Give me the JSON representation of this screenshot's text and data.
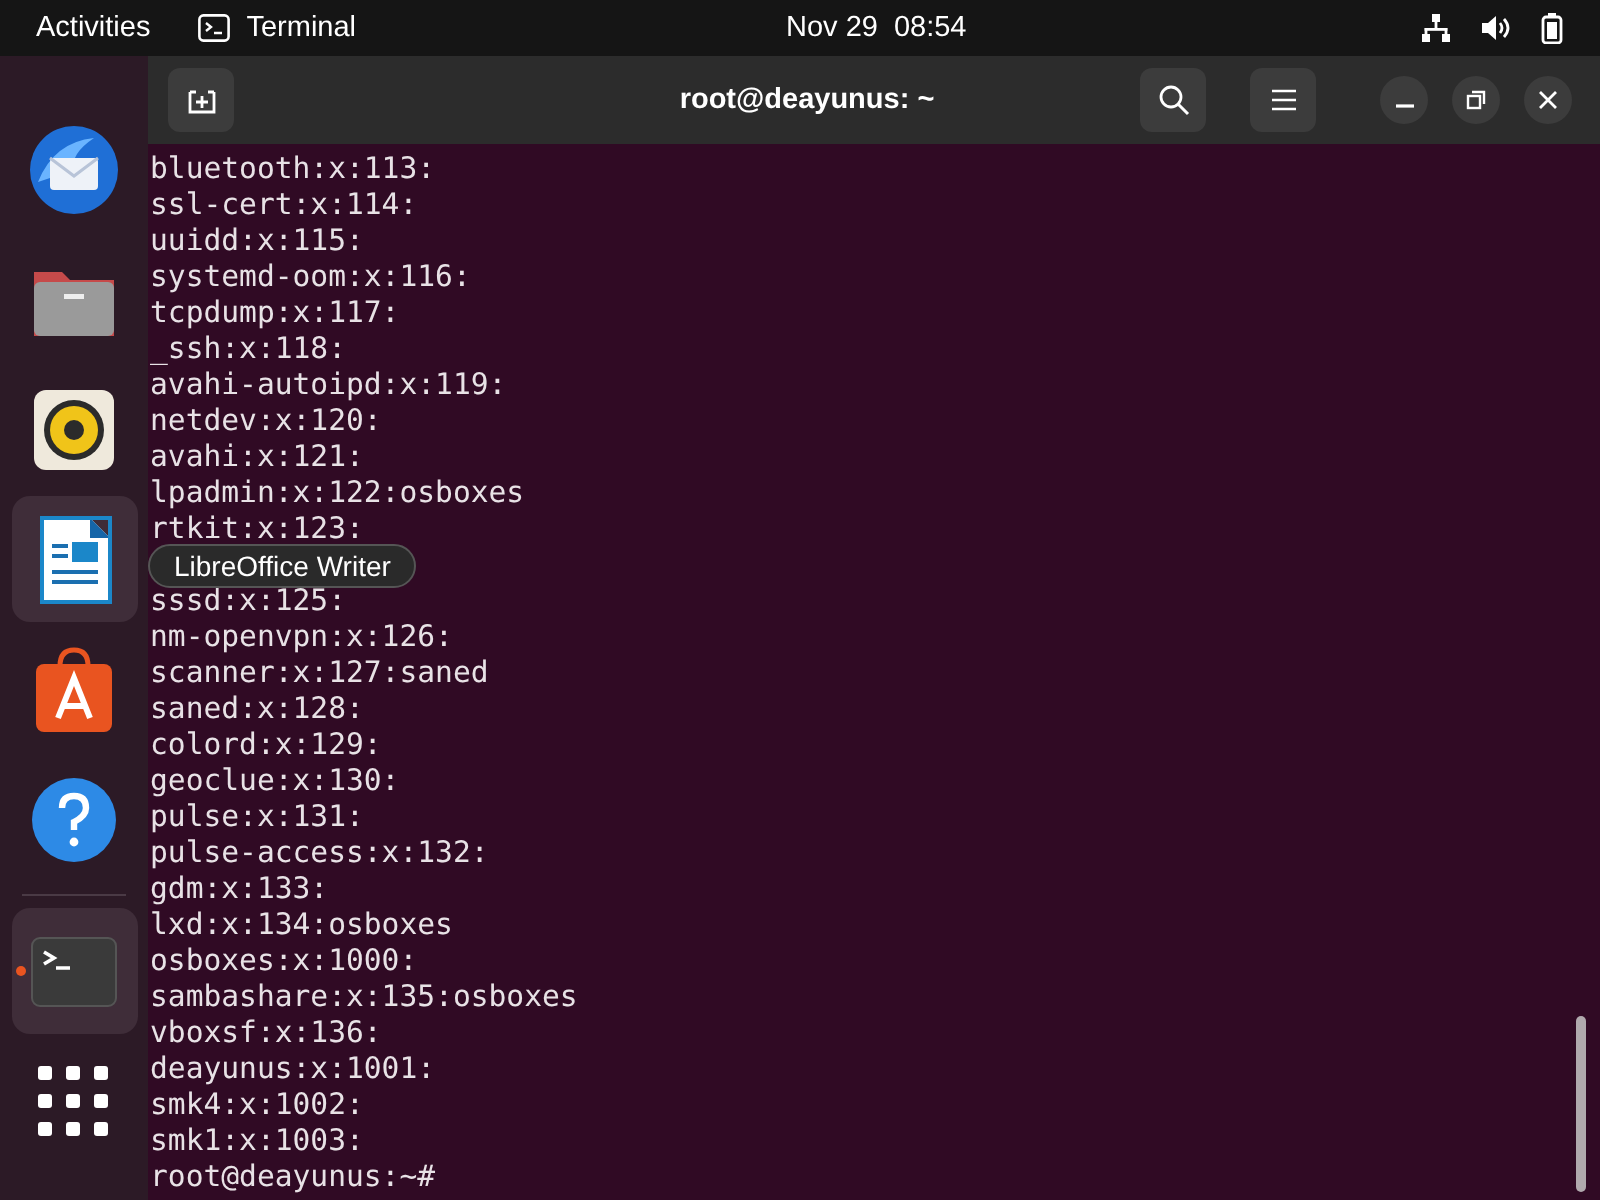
{
  "top_bar": {
    "activities": "Activities",
    "app_name": "Terminal",
    "date": "Nov 29",
    "time": "08:54"
  },
  "dock": {
    "items": [
      {
        "kind": "mail",
        "highlighted": false,
        "running": false
      },
      {
        "kind": "files",
        "highlighted": false,
        "running": false
      },
      {
        "kind": "music",
        "highlighted": false,
        "running": false
      },
      {
        "kind": "writer",
        "highlighted": true,
        "running": false
      },
      {
        "kind": "store",
        "highlighted": false,
        "running": false
      },
      {
        "kind": "help",
        "highlighted": false,
        "running": false
      },
      {
        "kind": "terminal",
        "highlighted": true,
        "running": true
      },
      {
        "kind": "apps",
        "highlighted": false,
        "running": false
      }
    ],
    "tooltip": "LibreOffice Writer"
  },
  "window": {
    "title": "root@deayunus: ~",
    "lines": [
      {
        "text": "bluetooth:x:113:"
      },
      {
        "text": "ssl-cert:x:114:"
      },
      {
        "text": "uuidd:x:115:"
      },
      {
        "text": "systemd-oom:x:116:"
      },
      {
        "text": "tcpdump:x:117:"
      },
      {
        "text": "_ssh:x:118:"
      },
      {
        "text": "avahi-autoipd:x:119:"
      },
      {
        "text": "netdev:x:120:"
      },
      {
        "text": "avahi:x:121:"
      },
      {
        "text": "lpadmin:x:122:osboxes"
      },
      {
        "text": "rtkit:x:123:"
      },
      {
        "kind": "hidden"
      },
      {
        "text": "sssd:x:125:"
      },
      {
        "text": "nm-openvpn:x:126:"
      },
      {
        "text": "scanner:x:127:saned"
      },
      {
        "text": "saned:x:128:"
      },
      {
        "text": "colord:x:129:"
      },
      {
        "text": "geoclue:x:130:"
      },
      {
        "text": "pulse:x:131:"
      },
      {
        "text": "pulse-access:x:132:"
      },
      {
        "text": "gdm:x:133:"
      },
      {
        "text": "lxd:x:134:osboxes"
      },
      {
        "text": "osboxes:x:1000:"
      },
      {
        "text": "sambashare:x:135:osboxes"
      },
      {
        "text": "vboxsf:x:136:"
      },
      {
        "text": "deayunus:x:1001:"
      },
      {
        "text": "smk4:x:1002:"
      },
      {
        "text": "smk1:x:1003:"
      },
      {
        "text": "root@deayunus:~#"
      }
    ]
  }
}
